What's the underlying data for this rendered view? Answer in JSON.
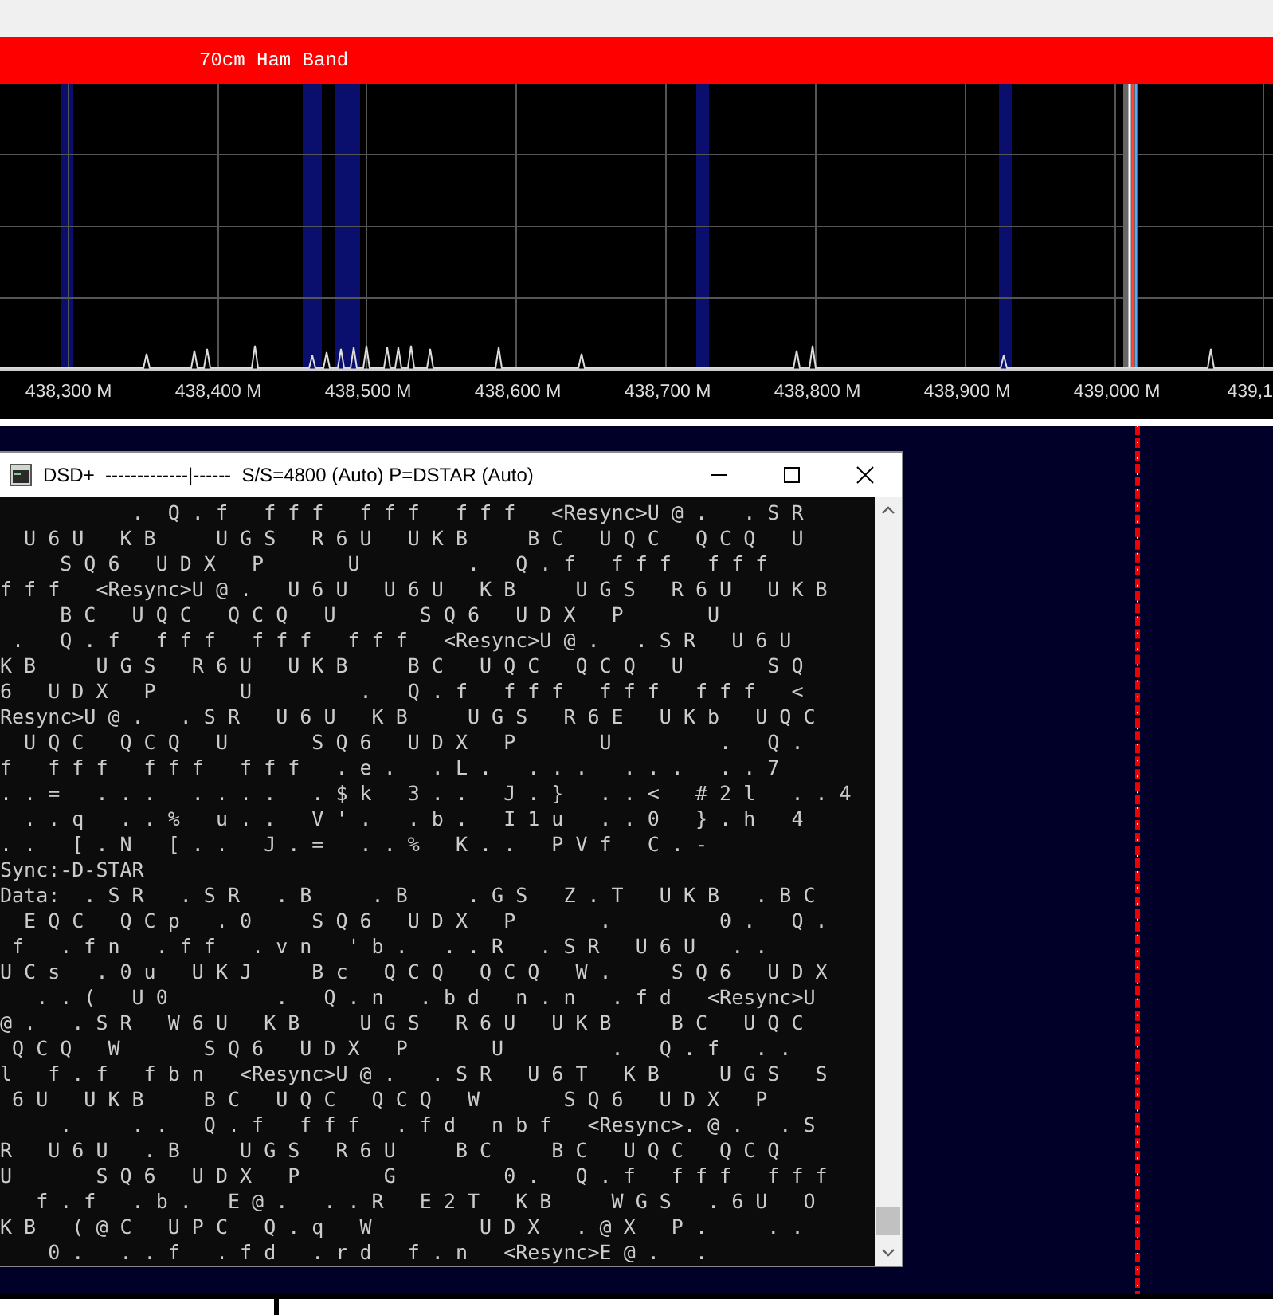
{
  "spectrum": {
    "band_label": "70cm Ham Band",
    "frequency_labels": [
      "438,300 M",
      "438,400 M",
      "438,500 M",
      "438,600 M",
      "438,700 M",
      "438,800 M",
      "438,900 M",
      "439,000 M",
      "439,1"
    ]
  },
  "console": {
    "title": "DSD+  -------------|------  S/S=4800 (Auto) P=DSTAR (Auto)",
    "lines": [
      "           .  Q . f   f f f   f f f   f f f   <Resync>U @ .   . S R",
      "  U 6 U   K B     U G S   R 6 U   U K B     B C   U Q C   Q C Q   U",
      "     S Q 6   U D X   P       U         .   Q . f   f f f   f f f",
      "f f f   <Resync>U @ .   U 6 U   U 6 U   K B     U G S   R 6 U   U K B",
      "     B C   U Q C   Q C Q   U       S Q 6   U D X   P       U",
      " .   Q . f   f f f   f f f   f f f   <Resync>U @ .   . S R   U 6 U",
      "K B     U G S   R 6 U   U K B     B C   U Q C   Q C Q   U       S Q",
      "6   U D X   P       U         .   Q . f   f f f   f f f   f f f   <",
      "Resync>U @ .   . S R   U 6 U   K B     U G S   R 6 E   U K b   U Q C",
      "  U Q C   Q C Q   U       S Q 6   U D X   P       U         .   Q .",
      "f   f f f   f f f   f f f   . e .   . L .   . . .   . . .   . . 7",
      ". . =   . . .   . . . .   . $ k   3 . .   J . }   . . <   # 2 l   . . 4",
      "  . . q   . . %   u . .   V ' .   . b .   I 1 u   . . 0   } . h   4",
      ". .   [ . N   [ . .   J . =   . . %   K . .   P V f   C . -",
      "Sync:-D-STAR",
      "Data:  . S R   . S R   . B     . B     . G S   Z . T   U K B   . B C",
      "  E Q C   Q C p   . 0     S Q 6   U D X   P       .         0 .   Q .",
      " f   . f n   . f f   . v n   ' b .   . . R   . S R   U 6 U   . .",
      "U C s   . 0 u   U K J     B c   Q C Q   Q C Q   W .     S Q 6   U D X",
      "   . . (   U 0         .   Q . n   . b d   n . n   . f d   <Resync>U",
      "@ .   . S R   W 6 U   K B     U G S   R 6 U   U K B     B C   U Q C",
      " Q C Q   W       S Q 6   U D X   P       U         .   Q . f   . .",
      "l   f . f   f b n   <Resync>U @ .   . S R   U 6 T   K B     U G S   S",
      " 6 U   U K B     B C   U Q C   Q C Q   W       S Q 6   U D X   P",
      "     .     . .   Q . f   f f f   . f d   n b f   <Resync>. @ .   . S",
      "R   U 6 U   . B     U G S   R 6 U     B C     B C   U Q C   Q C Q",
      "U       S Q 6   U D X   P       G         0 .   Q . f   f f f   f f f",
      "   f . f   . b .   E @ .   . . R   E 2 T   K B     W G S   . 6 U   O",
      "K B   ( @ C   U P C   Q . q   W         U D X   . @ X   P .     . .",
      "    0 .   . . f   . f d   . r d   f . n   <Resync>E @ .   ."
    ]
  }
}
